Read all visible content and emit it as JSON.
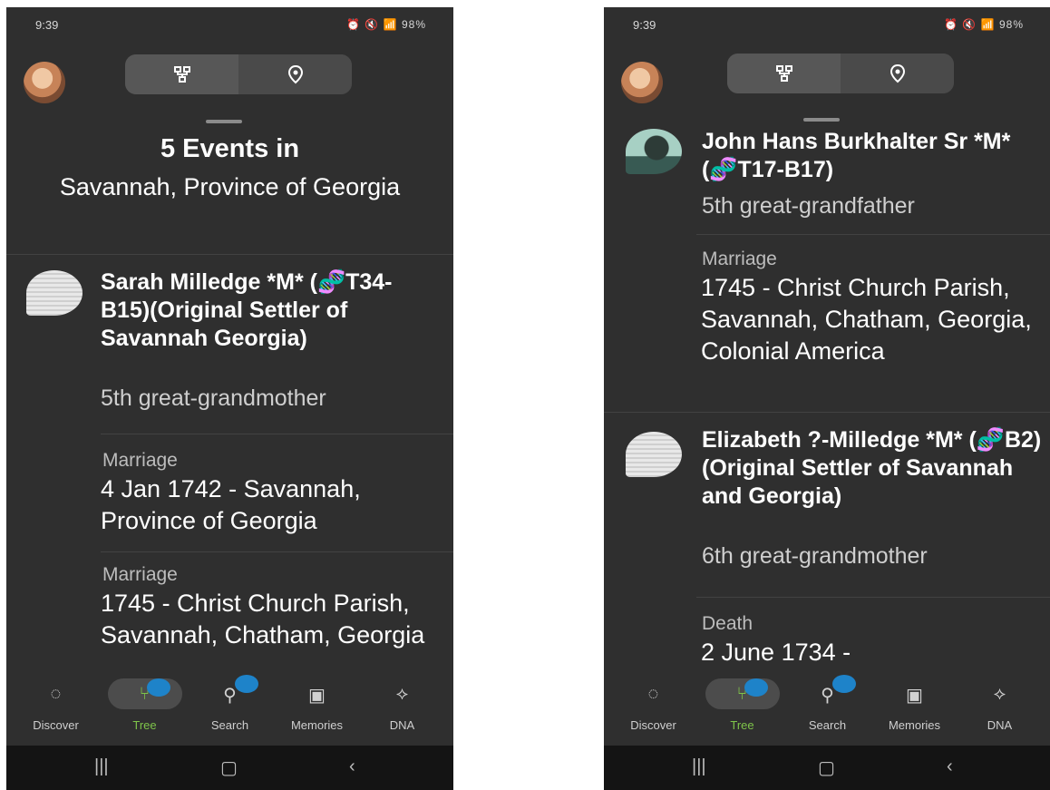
{
  "status_bar": {
    "time": "9:39",
    "indicators": "⏰ 🔇 📶 98%",
    "battery": "98%"
  },
  "header": {
    "tree_view_icon": "tree-icon",
    "map_view_icon": "map-pin-icon"
  },
  "left": {
    "events_title": "5 Events in",
    "events_place": "Savannah, Province of Georgia",
    "person": {
      "name_pre": "Sarah Milledge *M* (",
      "dna_emoji": "🧬",
      "name_post": "T34-B15)(Original Settler of Savannah Georgia)",
      "relation": "5th great-grandmother"
    },
    "events": [
      {
        "type": "Marriage",
        "detail": "4 Jan 1742 - Savannah, Province of Georgia"
      },
      {
        "type": "Marriage",
        "detail": "1745 - Christ Church Parish, Savannah, Chatham, Georgia"
      }
    ]
  },
  "right": {
    "person1": {
      "name_pre": "John Hans Burkhalter Sr *M* (",
      "dna_emoji": "🧬",
      "name_post": "T17-B17)",
      "relation": "5th great-grandfather",
      "event": {
        "type": "Marriage",
        "detail": "1745 - Christ Church Parish, Savannah, Chatham, Georgia, Colonial America"
      }
    },
    "person2": {
      "name_pre": "Elizabeth ?-Milledge *M* (",
      "dna_emoji": "🧬",
      "name_post": "B2)(Original Settler of Savannah and Georgia)",
      "relation": "6th great-grandmother",
      "event": {
        "type": "Death",
        "detail": "2 June 1734 -"
      }
    }
  },
  "nav": [
    {
      "label": "Discover",
      "icon": "discover-icon"
    },
    {
      "label": "Tree",
      "icon": "tree-icon"
    },
    {
      "label": "Search",
      "icon": "search-icon"
    },
    {
      "label": "Memories",
      "icon": "memories-icon"
    },
    {
      "label": "DNA",
      "icon": "dna-icon"
    }
  ],
  "colors": {
    "background": "#2f2f2f",
    "active": "#7ec34a",
    "badge": "#1e83c9"
  }
}
